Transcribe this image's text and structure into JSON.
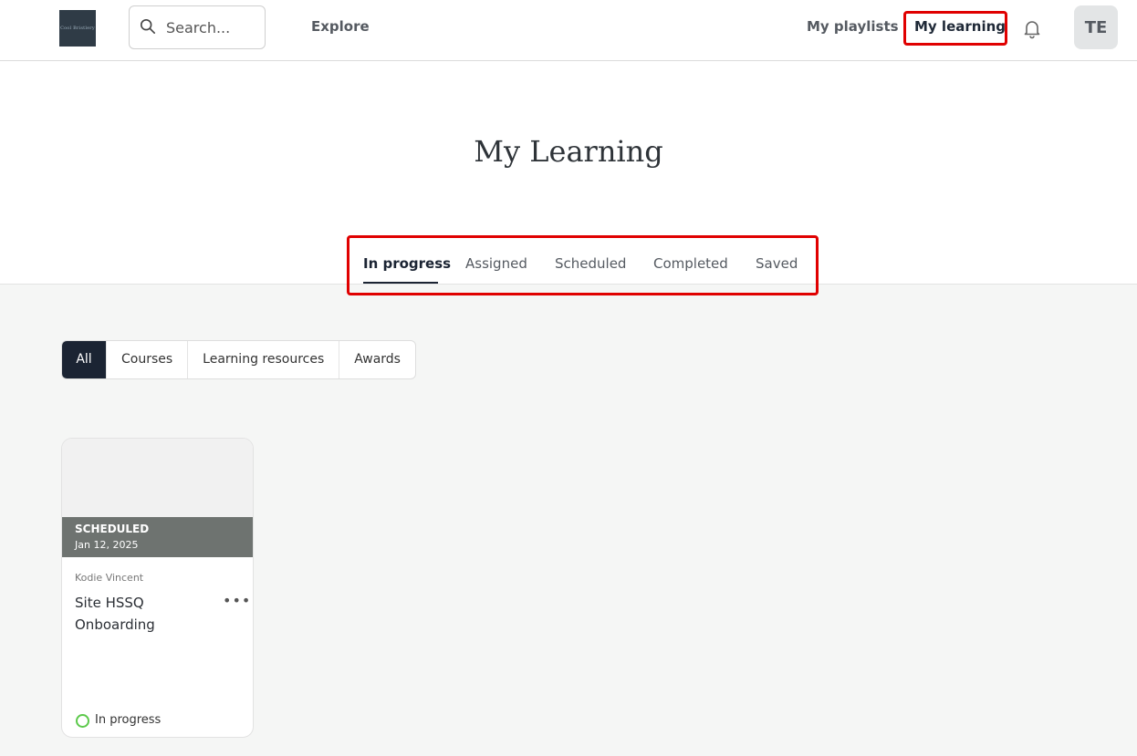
{
  "header": {
    "logo_text": "Cool Bristlery",
    "search_placeholder": "Search...",
    "explore_label": "Explore",
    "playlists_label": "My playlists",
    "my_learning_label": "My learning",
    "avatar_initials": "TE"
  },
  "page": {
    "title": "My Learning"
  },
  "tabs": [
    {
      "label": "In progress",
      "active": true
    },
    {
      "label": "Assigned"
    },
    {
      "label": "Scheduled"
    },
    {
      "label": "Completed"
    },
    {
      "label": "Saved"
    }
  ],
  "filters": [
    {
      "label": "All",
      "active": true
    },
    {
      "label": "Courses"
    },
    {
      "label": "Learning resources"
    },
    {
      "label": "Awards"
    }
  ],
  "card": {
    "status": "SCHEDULED",
    "date": "Jan 12, 2025",
    "author": "Kodie Vincent",
    "title": "Site HSSQ Onboarding",
    "progress_label": "In progress",
    "more_icon": "more-horizontal-icon"
  },
  "colors": {
    "highlight_box": "#e00000",
    "active_dark": "#1b2433",
    "progress_green": "#5cc94b"
  }
}
